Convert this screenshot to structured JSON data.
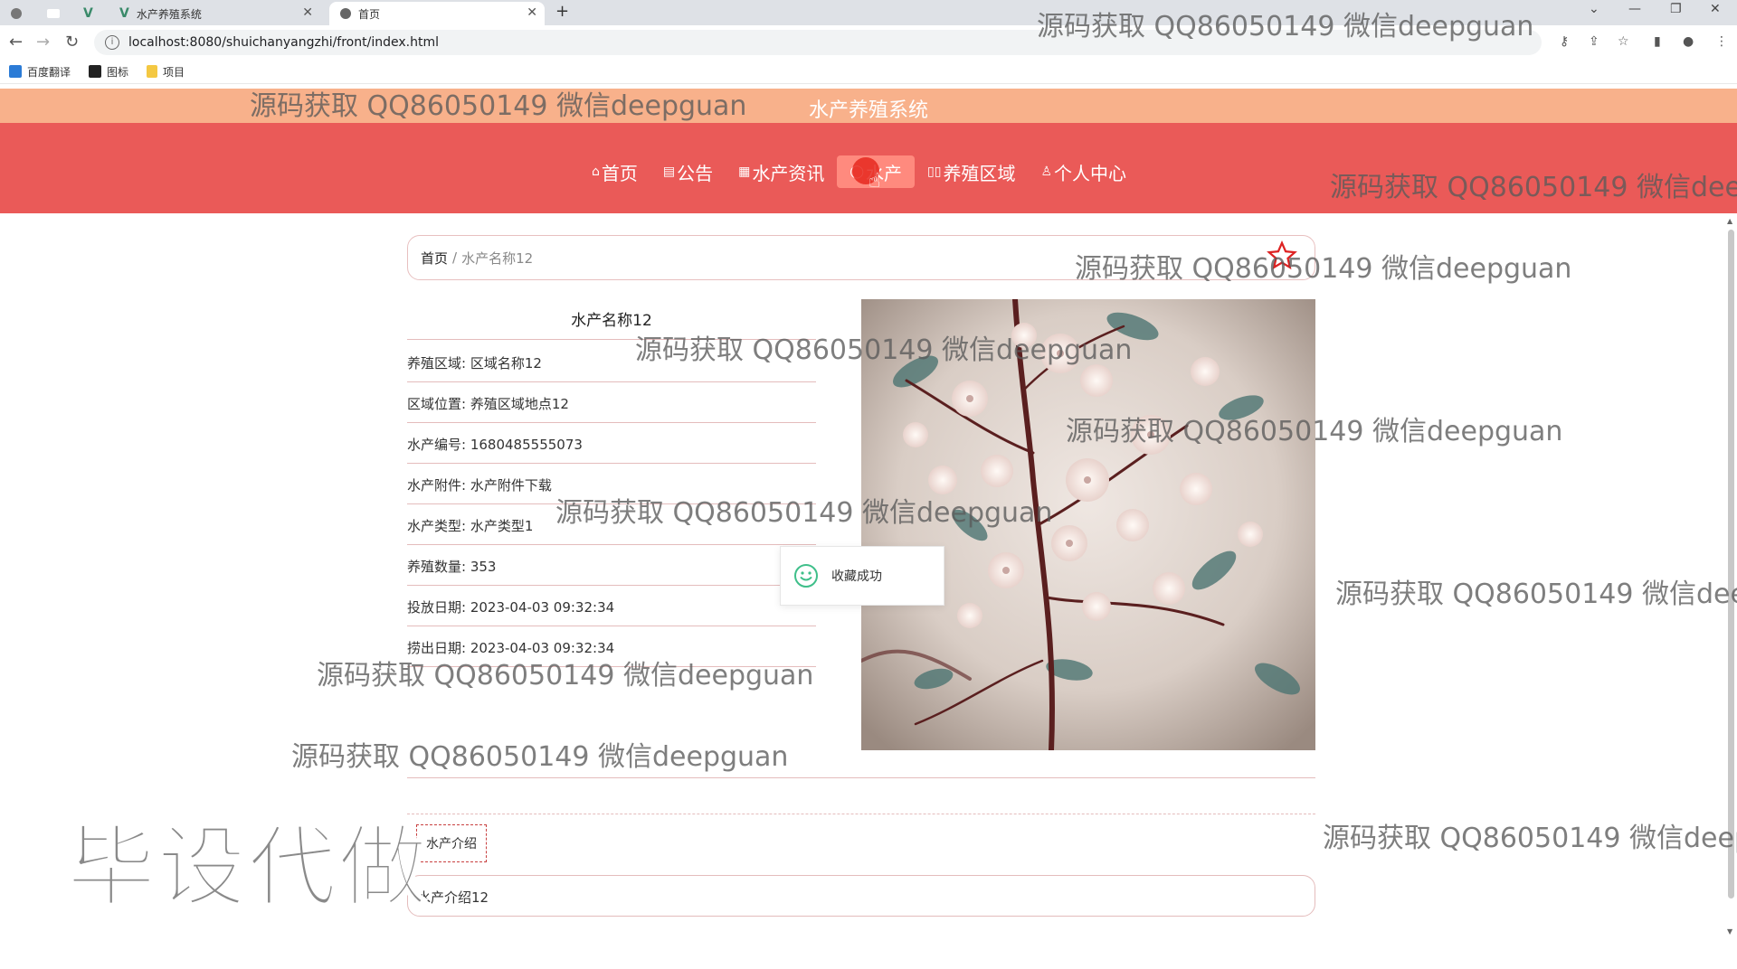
{
  "browser": {
    "tabs": [
      {
        "label": "",
        "icon": "globe-icon"
      },
      {
        "label": "",
        "icon": "blank-page-icon"
      },
      {
        "label": "",
        "icon": "vue-icon"
      },
      {
        "label": "水产养殖系统",
        "icon": "vue-icon"
      },
      {
        "label": "首页",
        "icon": "globe-icon"
      }
    ],
    "url": "localhost:8080/shuichanyangzhi/front/index.html",
    "bookmarks": [
      {
        "label": "百度翻译",
        "icon": "translate-icon"
      },
      {
        "label": "图标",
        "icon": "image-icon"
      },
      {
        "label": "项目",
        "icon": "folder-icon"
      }
    ]
  },
  "site": {
    "title": "水产养殖系统",
    "nav": [
      {
        "label": "首页",
        "icon": "⌂"
      },
      {
        "label": "公告",
        "icon": "▤"
      },
      {
        "label": "水产资讯",
        "icon": "▦"
      },
      {
        "label": "水产",
        "icon": "◯"
      },
      {
        "label": "养殖区域",
        "icon": "▯▯"
      },
      {
        "label": "个人中心",
        "icon": "♙"
      }
    ],
    "active_nav_index": 3
  },
  "breadcrumb": {
    "home": "首页",
    "separator": "/",
    "current": "水产名称12"
  },
  "detail": {
    "title": "水产名称12",
    "fields": [
      {
        "label": "养殖区域:",
        "value": "区域名称12"
      },
      {
        "label": "区域位置:",
        "value": "养殖区域地点12"
      },
      {
        "label": "水产编号:",
        "value": "1680485555073"
      },
      {
        "label": "水产附件:",
        "value": "水产附件下载"
      },
      {
        "label": "水产类型:",
        "value": "水产类型1"
      },
      {
        "label": "养殖数量:",
        "value": "353"
      },
      {
        "label": "投放日期:",
        "value": "2023-04-03 09:32:34"
      },
      {
        "label": "捞出日期:",
        "value": "2023-04-03 09:32:34"
      }
    ]
  },
  "toast": {
    "text": "收藏成功"
  },
  "intro": {
    "tab_label": "水产介绍",
    "content": "水产介绍12"
  },
  "watermark": {
    "text": "源码获取 QQ86050149 微信deepguan",
    "big_text": "毕设代做"
  },
  "colors": {
    "top_strip": "#f8b18b",
    "nav_bar": "#ea5a58",
    "nav_active": "#ff8a7e",
    "border": "#e4bcbc"
  }
}
